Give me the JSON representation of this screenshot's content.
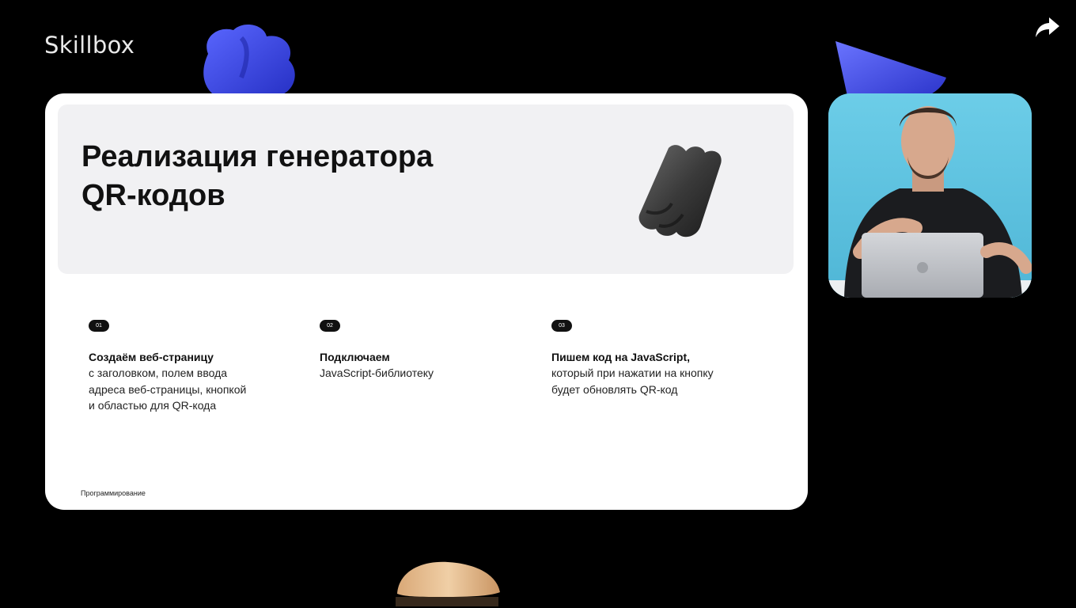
{
  "brand": {
    "logo_text": "Skillbox"
  },
  "slide": {
    "title_lines": [
      "Реализация генератора",
      "QR-кодов"
    ],
    "steps": [
      {
        "number": "01",
        "title": "Создаём веб-страницу",
        "body": "с заголовком, полем ввода\nадреса веб-страницы, кнопкой\nи областью для QR-кода"
      },
      {
        "number": "02",
        "title": "Подключаем",
        "body": "JavaScript-библиотеку"
      },
      {
        "number": "03",
        "title": "Пишем код на JavaScript,",
        "body": "который при нажатии на кнопку\nбудет обновлять QR-код"
      }
    ],
    "footer": "Программирование"
  },
  "controls": {
    "share_icon": "share-arrow-icon"
  },
  "colors": {
    "background": "#000000",
    "slide_bg": "#ffffff",
    "header_bg": "#f1f1f3",
    "accent_blue": "#3d49e6",
    "camera_bg": "#5ec3e0"
  }
}
